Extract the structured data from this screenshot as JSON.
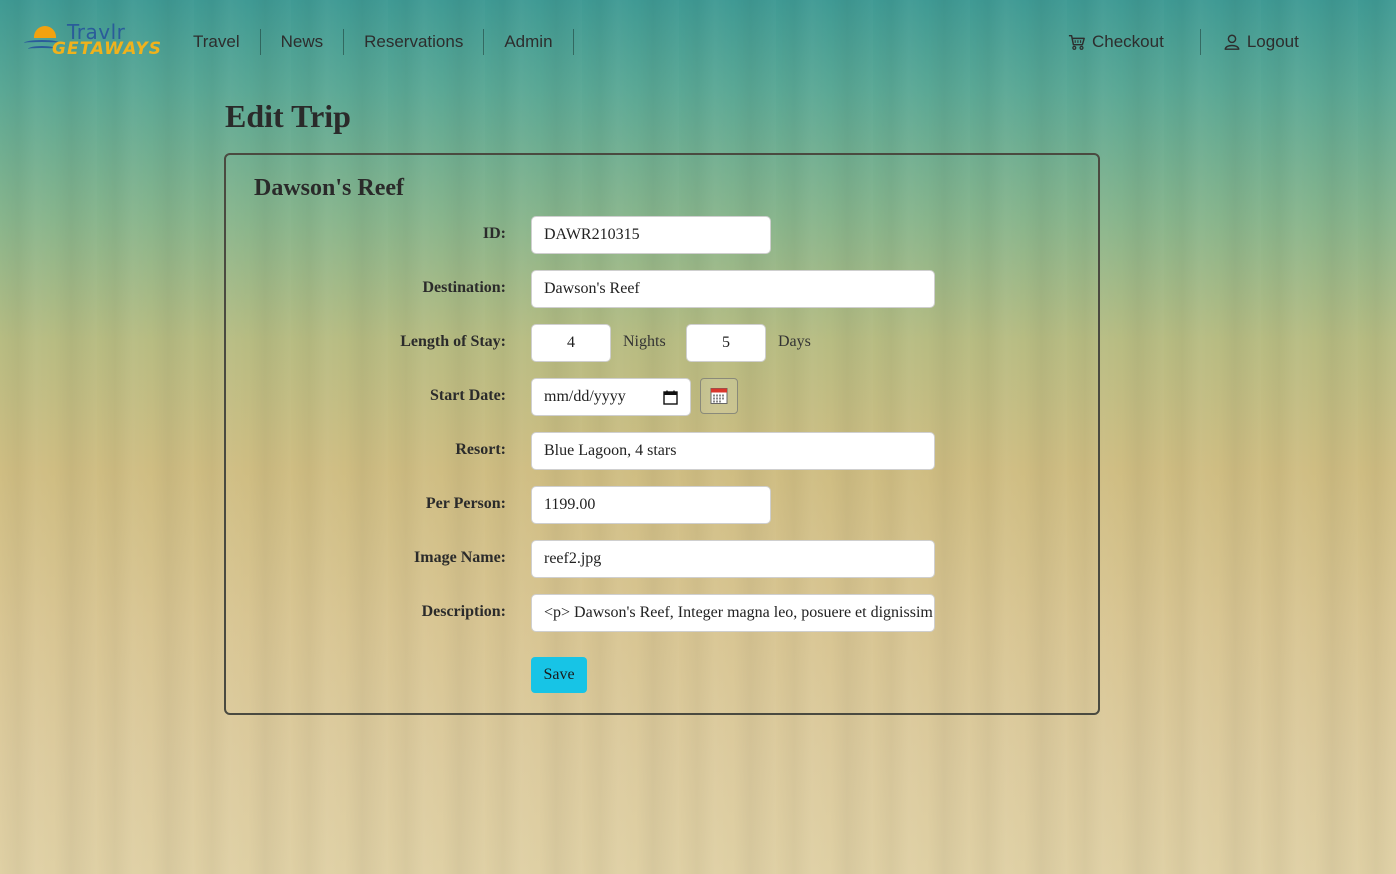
{
  "brand": {
    "name_top": "Travlr",
    "name_bottom": "GETAWAYS"
  },
  "nav": {
    "left": [
      "Travel",
      "News",
      "Reservations",
      "Admin"
    ],
    "checkout": "Checkout",
    "logout": "Logout"
  },
  "page": {
    "title": "Edit Trip"
  },
  "form": {
    "heading": "Dawson's Reef",
    "id_label": "ID:",
    "id_value": "DAWR210315",
    "destination_label": "Destination:",
    "destination_value": "Dawson's Reef",
    "length_label": "Length of Stay:",
    "nights_value": "4",
    "nights_unit": "Nights",
    "days_value": "5",
    "days_unit": "Days",
    "start_date_label": "Start Date:",
    "start_date_placeholder": "mm/dd/yyyy",
    "resort_label": "Resort:",
    "resort_value": "Blue Lagoon, 4 stars",
    "per_person_label": "Per Person:",
    "per_person_value": "1199.00",
    "image_label": "Image Name:",
    "image_value": "reef2.jpg",
    "description_label": "Description:",
    "description_value": "<p> Dawson's Reef, Integer magna leo, posuere et dignissim vi",
    "save_label": "Save"
  },
  "icons": {
    "checkout": "cart-icon",
    "logout": "user-icon",
    "date_picker": "calendar-icon",
    "calendar_button": "calendar-icon"
  },
  "colors": {
    "save_button": "#17c4e6",
    "brand_blue": "#2a5c9a",
    "brand_gold": "#f0b21c"
  }
}
